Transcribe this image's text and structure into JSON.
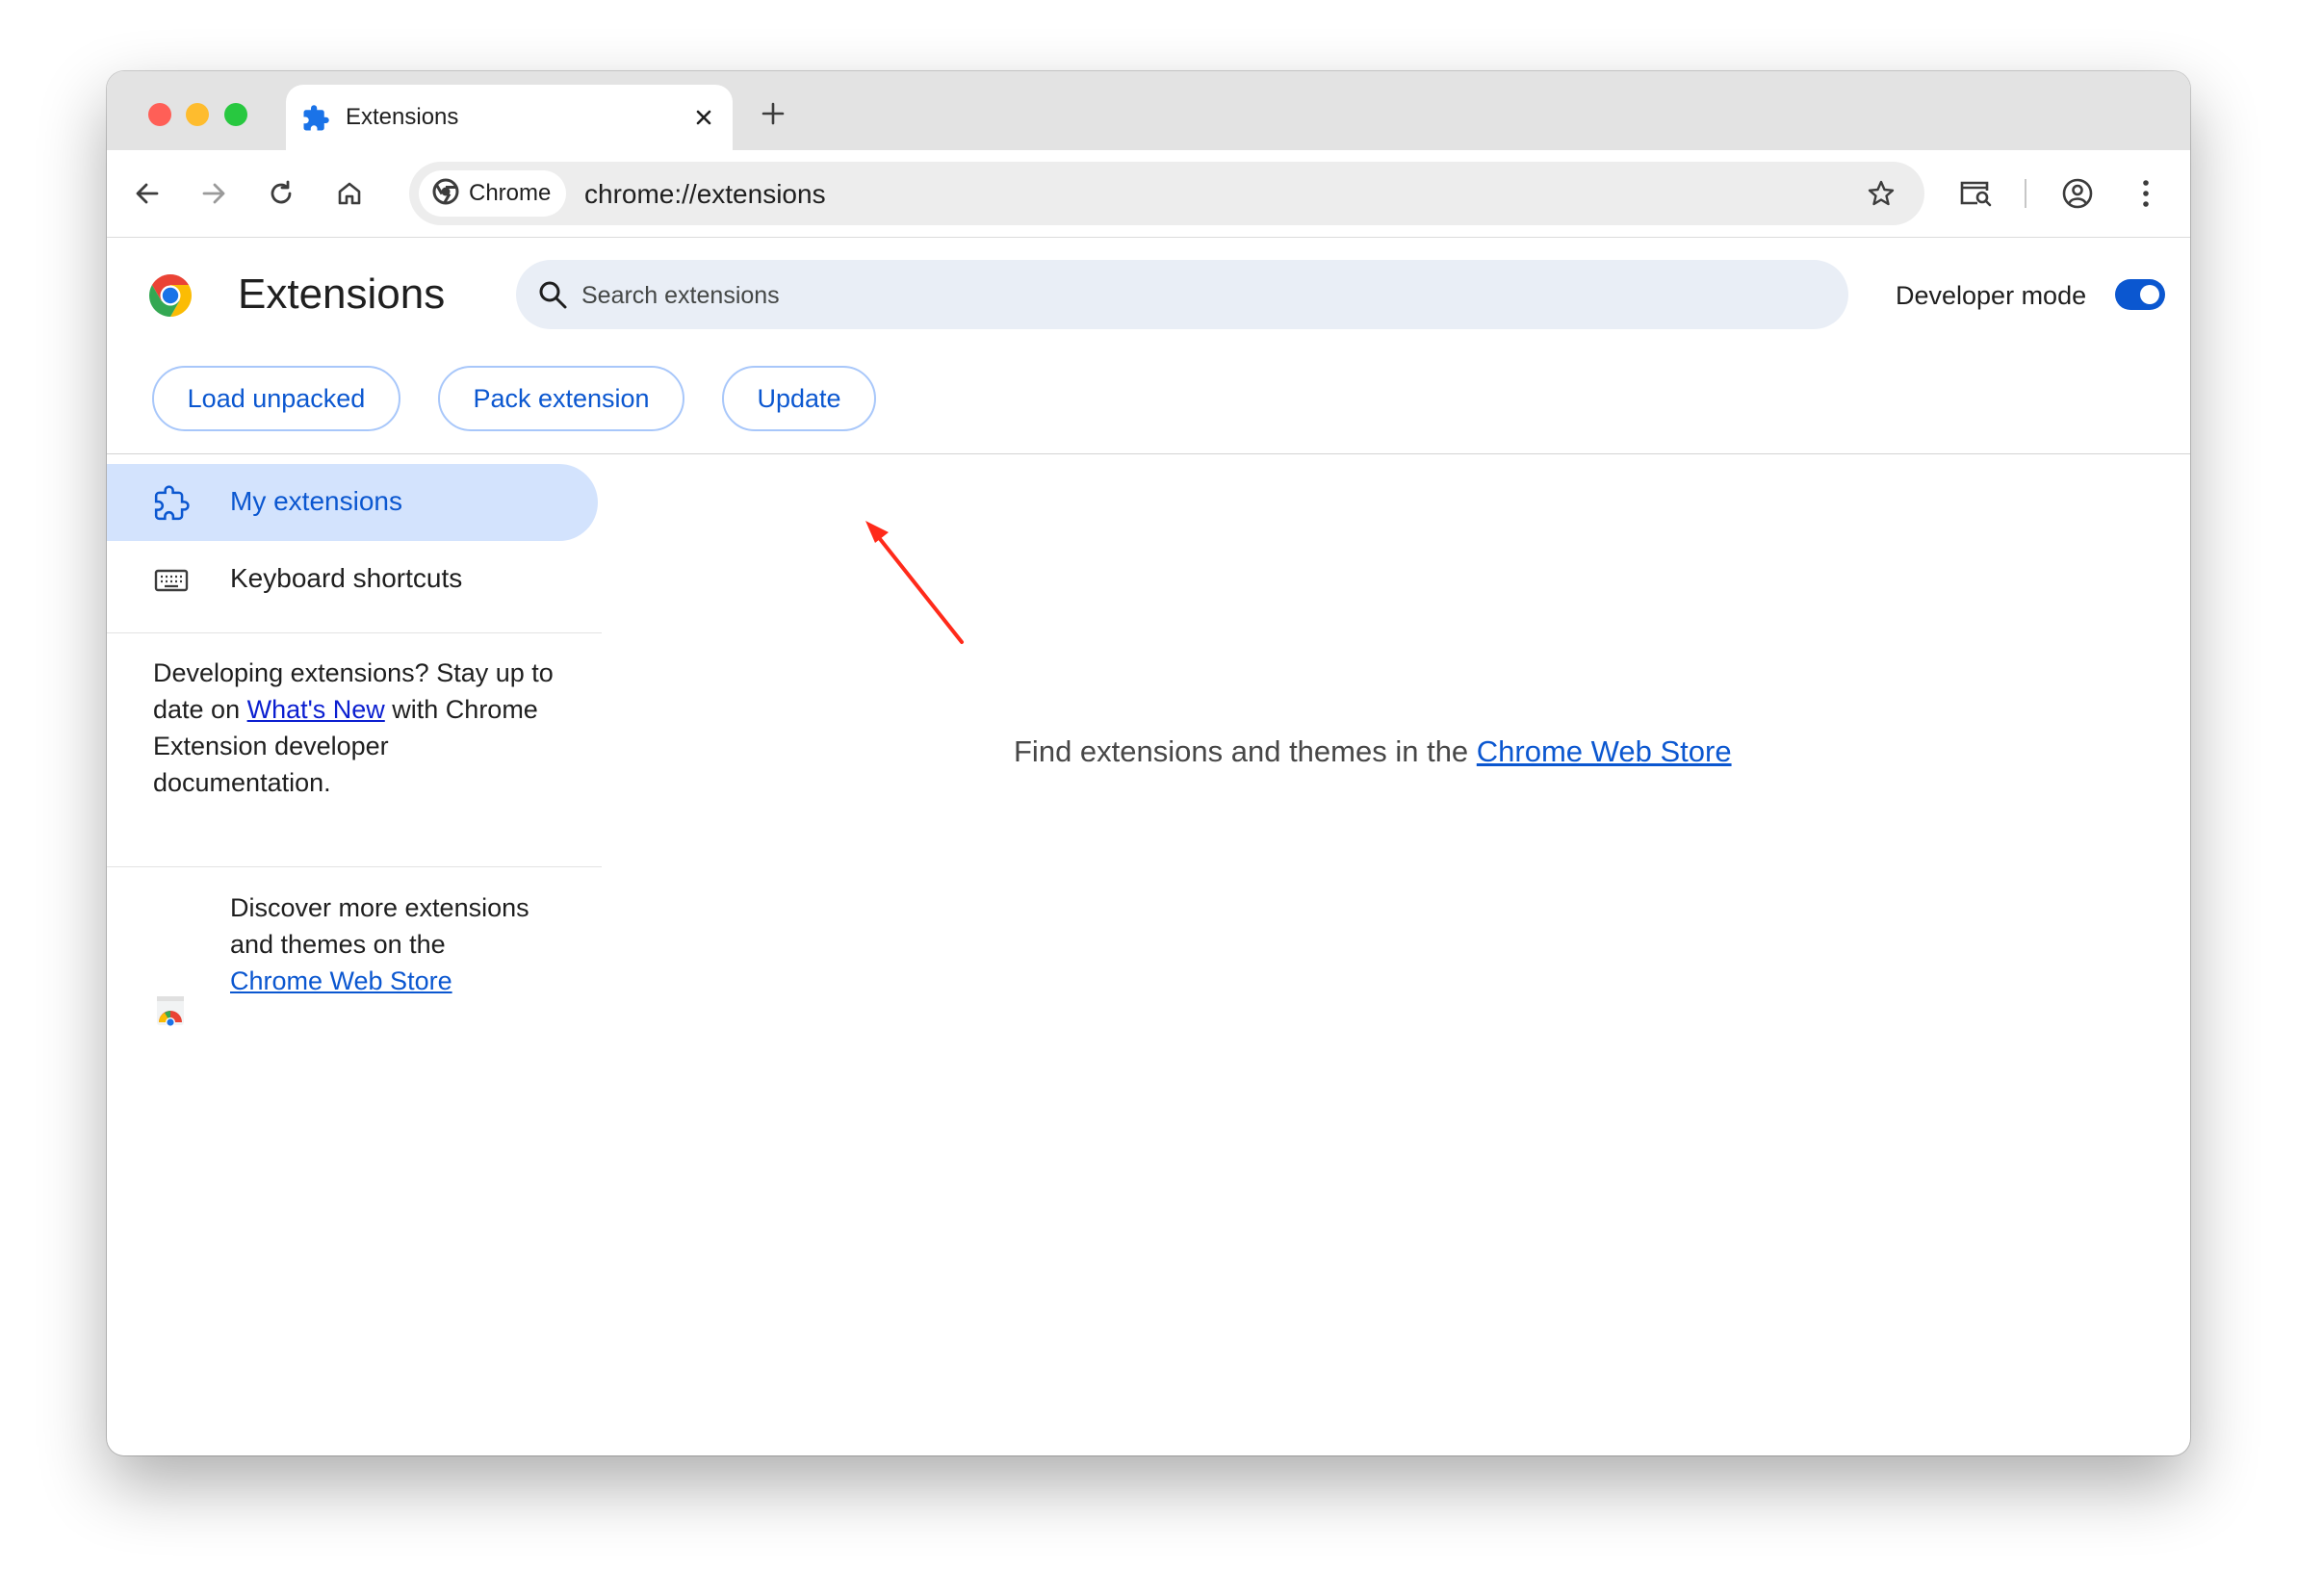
{
  "tab": {
    "title": "Extensions",
    "icon": "puzzle-icon"
  },
  "toolbar": {
    "chip_label": "Chrome",
    "url": "chrome://extensions"
  },
  "header": {
    "title": "Extensions",
    "search_placeholder": "Search extensions",
    "developer_mode_label": "Developer mode",
    "developer_mode_on": true,
    "buttons": {
      "load_unpacked": "Load unpacked",
      "pack_extension": "Pack extension",
      "update": "Update"
    }
  },
  "sidebar": {
    "items": [
      {
        "label": "My extensions",
        "icon": "puzzle-outline-icon",
        "active": true
      },
      {
        "label": "Keyboard shortcuts",
        "icon": "keyboard-icon",
        "active": false
      }
    ],
    "developing": {
      "prefix": "Developing extensions? Stay up to date on ",
      "link": "What's New",
      "suffix": " with Chrome Extension developer documentation."
    },
    "discover": {
      "prefix": "Discover more extensions and themes on the ",
      "link": "Chrome Web Store"
    }
  },
  "main": {
    "message_prefix": "Find extensions and themes in the ",
    "message_link": "Chrome Web Store"
  },
  "colors": {
    "accent": "#0b57d0",
    "annotation": "#ff2a1a"
  }
}
